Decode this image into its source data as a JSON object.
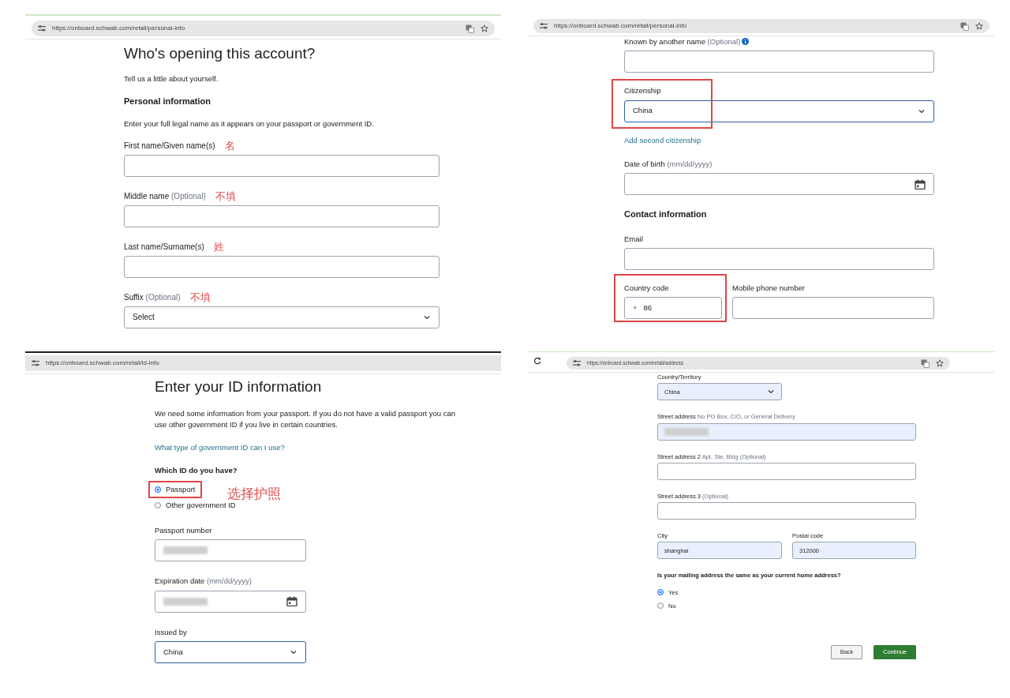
{
  "panels": [
    {
      "url": "https://onboard.schwab.com/retail/personal-info",
      "items": [
        {
          "kind": "title",
          "text": "Who's opening this account?"
        },
        {
          "kind": "text",
          "text": "Tell us a little about yourself."
        },
        {
          "kind": "section",
          "text": "Personal information"
        },
        {
          "kind": "text",
          "text": "Enter your full legal name as it appears on your passport or government ID."
        },
        {
          "kind": "text_field",
          "label": "First name/Given name(s)",
          "note": "名",
          "focused": false,
          "autofilled": false,
          "highlighted": false,
          "redacted": false
        },
        {
          "kind": "text_field",
          "label": "Middle name",
          "hint": "(Optional)",
          "note": "不填",
          "focused": false,
          "autofilled": false,
          "highlighted": false,
          "redacted": false
        },
        {
          "kind": "text_field",
          "label": "Last name/Surname(s)",
          "note": "姓",
          "focused": false,
          "autofilled": false,
          "highlighted": false,
          "redacted": false
        },
        {
          "kind": "select",
          "label": "Suffix",
          "hint": "(Optional)",
          "value": "Select",
          "note": "不填",
          "focused": false,
          "autofilled": false,
          "highlighted": false,
          "redacted": false
        }
      ]
    },
    {
      "url": "https://onboard.schwab.com/retail/personal-info",
      "items": [
        {
          "kind": "text_field",
          "label": "Known by another name",
          "hint": "(Optional)",
          "info": true,
          "focused": false,
          "autofilled": false,
          "highlighted": false,
          "redacted": false
        },
        {
          "kind": "select",
          "label": "Citizenship",
          "value": "China",
          "focused": true,
          "autofilled": false,
          "highlighted": true,
          "redacted": false
        },
        {
          "kind": "link",
          "text": "Add second citizenship"
        },
        {
          "kind": "date_field",
          "label": "Date of birth",
          "hint": " (mm/dd/yyyy)",
          "focused": false,
          "autofilled": false,
          "highlighted": false,
          "redacted": false
        },
        {
          "kind": "section",
          "text": "Contact information"
        },
        {
          "kind": "text_field",
          "label": "Email",
          "focused": false,
          "autofilled": false,
          "highlighted": false,
          "redacted": false
        },
        {
          "kind": "row",
          "fields": [
            {
              "kind": "text_field",
              "label": "Country code",
              "prefix": "+",
              "value": "86",
              "focused": false,
              "autofilled": false,
              "highlighted": true,
              "redacted": false
            },
            {
              "kind": "text_field",
              "label": "Mobile phone number",
              "focused": false,
              "autofilled": false,
              "highlighted": false,
              "redacted": false
            }
          ]
        }
      ]
    },
    {
      "url": "https://onboard.schwab.com/retail/id-info",
      "items": [
        {
          "kind": "title",
          "text": "Enter your ID information"
        },
        {
          "kind": "text",
          "text": "We need some information from your passport. If you do not have a valid passport you can use other government ID if you live in certain countries."
        },
        {
          "kind": "link",
          "text": "What type of government ID can I use?"
        },
        {
          "kind": "radio_group",
          "label": "Which ID do you have?",
          "options": [
            {
              "label": "Passport",
              "selected": true,
              "highlighted": true,
              "note": "选择护照"
            },
            {
              "label": "Other government ID",
              "selected": false,
              "highlighted": false
            }
          ]
        },
        {
          "kind": "text_field",
          "label": "Passport number",
          "focused": false,
          "autofilled": false,
          "highlighted": false,
          "redacted": true
        },
        {
          "kind": "date_field",
          "label": "Expiration date",
          "hint": "(mm/dd/yyyy)",
          "focused": false,
          "autofilled": false,
          "highlighted": false,
          "redacted": true
        },
        {
          "kind": "select",
          "label": "Issued by",
          "value": "China",
          "focused": true,
          "autofilled": false,
          "highlighted": false,
          "redacted": false
        }
      ]
    },
    {
      "url": "https://onboard.schwab.com/retail/address",
      "items": [
        {
          "kind": "select",
          "label": "Country/Territory",
          "value": "China",
          "focused": false,
          "autofilled": true,
          "highlighted": false,
          "redacted": false
        },
        {
          "kind": "text_field",
          "label": "Street address",
          "hint": "No PO Box, C/O, or General Delivery",
          "focused": false,
          "autofilled": true,
          "highlighted": false,
          "redacted": true
        },
        {
          "kind": "text_field",
          "label": "Street address 2",
          "hint": "Apt, Ste, Bldg (Optional)",
          "focused": false,
          "autofilled": false,
          "highlighted": false,
          "redacted": false
        },
        {
          "kind": "text_field",
          "label": "Street address 3",
          "hint": "(Optional)",
          "focused": false,
          "autofilled": false,
          "highlighted": false,
          "redacted": false
        },
        {
          "kind": "row",
          "fields": [
            {
              "kind": "text_field",
              "label": "City",
              "value": "shanghai",
              "focused": false,
              "autofilled": true,
              "highlighted": false,
              "redacted": false
            },
            {
              "kind": "text_field",
              "label": "Postal code",
              "value": "312000",
              "focused": false,
              "autofilled": true,
              "highlighted": false,
              "redacted": false
            }
          ]
        },
        {
          "kind": "radio_group",
          "label": "Is your mailing address the same as your current home address?",
          "options": [
            {
              "label": "Yes",
              "selected": true,
              "highlighted": false
            },
            {
              "label": "No",
              "selected": false,
              "highlighted": false
            }
          ]
        },
        {
          "kind": "buttons",
          "buttons": [
            {
              "label": "Back",
              "kind": "secondary"
            },
            {
              "label": "Continue",
              "kind": "primary"
            }
          ]
        }
      ]
    }
  ]
}
